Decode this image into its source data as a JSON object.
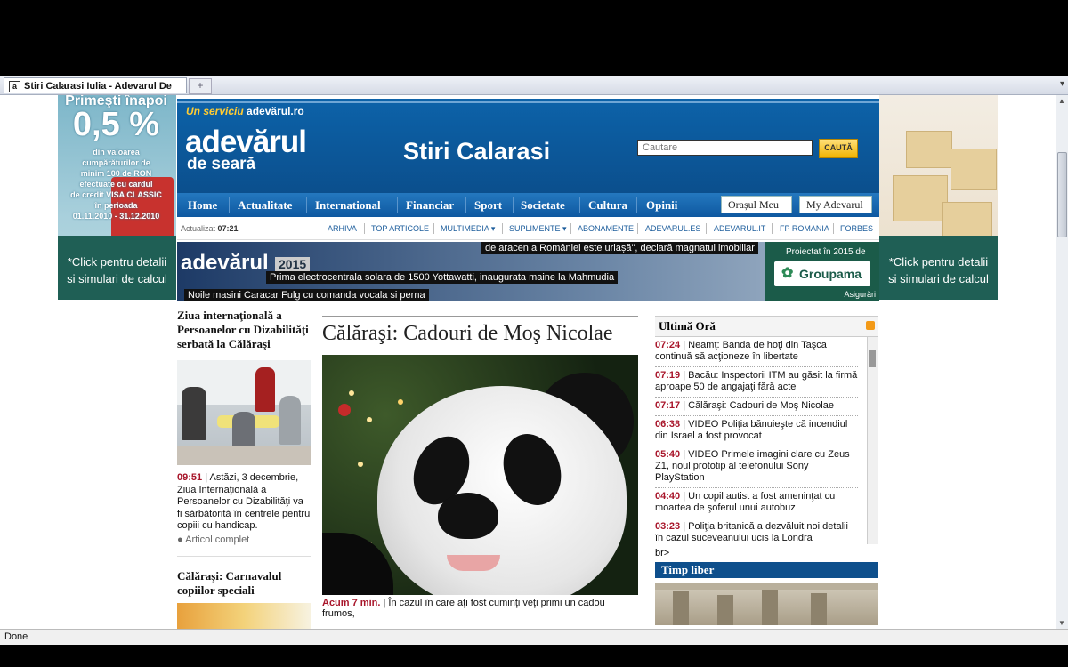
{
  "browser": {
    "tab_title": "Stiri Calarasi Iulia - Adevarul De Seara",
    "favicon": "a",
    "new_tab": "+",
    "status": "Done"
  },
  "ad_left": {
    "headline": "Primeşti înapoi",
    "percent": "0,5 %",
    "lines": [
      "din valoarea",
      "cumpărăturilor de",
      "minim 100 de RON",
      "efectuate cu cardul",
      "de credit VISA CLASSIC",
      "în perioada",
      "01.11.2010 - 31.12.2010"
    ],
    "cta_line1": "*Click pentru detalii",
    "cta_line2": "si simulari de calcul"
  },
  "ad_right": {
    "cta_line1": "*Click pentru detalii",
    "cta_line2": "si simulari de calcul"
  },
  "header": {
    "service_prefix": "Un serviciu",
    "service_brand": "adevărul.ro",
    "logo_main": "adevărul",
    "logo_sub": "de seară",
    "site_title": "Stiri Calarasi",
    "search_placeholder": "Cautare",
    "search_button": "CAUTĂ"
  },
  "nav": {
    "items": [
      "Home",
      "Actualitate",
      "International",
      "Financiar",
      "Sport",
      "Societate",
      "Cultura",
      "Opinii"
    ],
    "city_button": "Orașul Meu",
    "my_button": "My Adevarul"
  },
  "subnav": {
    "updated_label": "Actualizat",
    "updated_time": "07:21",
    "links": [
      "ARHIVA",
      "TOP ARTICOLE",
      "MULTIMEDIA",
      "SUPLIMENTE",
      "ABONAMENTE",
      "ADEVARUL.ES",
      "ADEVARUL.IT",
      "FP ROMANIA",
      "FORBES"
    ]
  },
  "banner": {
    "logo": "adevărul",
    "year": "2015",
    "ticker1": "de aracen a României este uriașă\", declară magnatul imobiliar",
    "ticker2": "Prima electrocentrala solara de 1500 Yottawatti, inaugurata maine la Mahmudia",
    "ticker3": "Noile masini Caracar Fulg cu comanda vocala si perna",
    "sponsor_line": "Proiectat în 2015 de",
    "sponsor_name": "Groupama",
    "sponsor_sub": "Asigurări"
  },
  "left_stories": [
    {
      "title": "Ziua internaţională a Persoanelor cu Dizabilităţi serbată la Călăraşi",
      "time": "09:51",
      "text": "Astăzi, 3 decembrie, Ziua Internaţională a Persoanelor cu Dizabilităţi va fi sărbătorită în centrele pentru copiii cu handicap.",
      "more": "Articol complet"
    },
    {
      "title": "Călăraşi: Carnavalul copiilor speciali"
    }
  ],
  "main": {
    "title": "Călăraşi: Cadouri de Moş Nicolae",
    "lede_time": "Acum 7 min.",
    "lede_text": "În cazul în care aţi fost cuminţi veţi primi un cadou frumos,"
  },
  "ultima_ora": {
    "title": "Ultimă Oră",
    "items": [
      {
        "time": "07:24",
        "text": "Neamţ: Banda de hoţi din Taşca continuă să acţioneze în libertate"
      },
      {
        "time": "07:19",
        "text": "Bacău: Inspectorii ITM au găsit la firmă aproape 50 de angajaţi fără acte"
      },
      {
        "time": "07:17",
        "text": "Călăraşi: Cadouri de Moş Nicolae"
      },
      {
        "time": "06:38",
        "text": "VIDEO Poliţia bănuieşte că incendiul din Israel a fost provocat"
      },
      {
        "time": "05:40",
        "text": "VIDEO Primele imagini clare cu Zeus Z1, noul prototip al telefonului Sony PlayStation"
      },
      {
        "time": "04:40",
        "text": "Un copil autist a fost ameninţat cu moartea de şoferul unui autobuz"
      },
      {
        "time": "03:23",
        "text": "Poliţia britanică a dezvăluit noi detalii în cazul suceveanului ucis la Londra"
      }
    ],
    "after": "br>",
    "section": "Timp liber"
  }
}
